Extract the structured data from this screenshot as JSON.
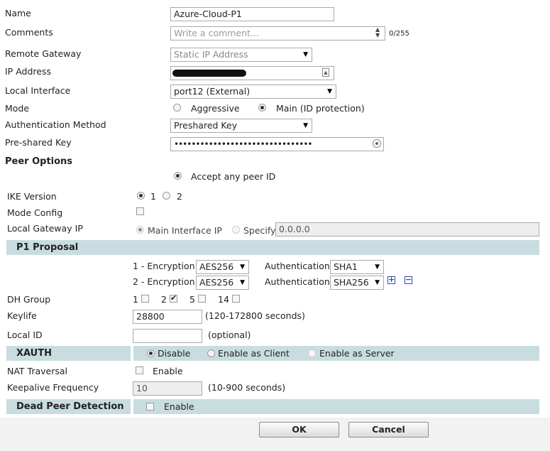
{
  "fields": {
    "name_label": "Name",
    "name_value": "Azure-Cloud-P1",
    "comments_label": "Comments",
    "comments_placeholder": "Write a comment...",
    "comments_count": "0/255",
    "remote_gateway_label": "Remote Gateway",
    "remote_gateway_value": "Static IP Address",
    "ip_address_label": "IP Address",
    "local_interface_label": "Local Interface",
    "local_interface_value": "port12 (External)",
    "mode_label": "Mode",
    "mode_aggressive": "Aggressive",
    "mode_main": "Main (ID protection)",
    "auth_method_label": "Authentication Method",
    "auth_method_value": "Preshared Key",
    "psk_label": "Pre-shared Key",
    "psk_value": "••••••••••••••••••••••••••••••••"
  },
  "peer_options": {
    "title": "Peer Options",
    "accept_any": "Accept any peer ID"
  },
  "ike": {
    "version_label": "IKE Version",
    "v1": "1",
    "v2": "2",
    "mode_config_label": "Mode Config",
    "local_gw_label": "Local Gateway IP",
    "main_interface_ip": "Main Interface IP",
    "specify": "Specify",
    "specify_value": "0.0.0.0"
  },
  "p1_proposal": {
    "title": "P1 Proposal",
    "row1_label": "1 - Encryption",
    "row1_enc": "AES256",
    "row1_auth_label": "Authentication",
    "row1_auth": "SHA1",
    "row2_label": "2 - Encryption",
    "row2_enc": "AES256",
    "row2_auth_label": "Authentication",
    "row2_auth": "SHA256",
    "dh_label": "DH Group",
    "dh1": "1",
    "dh2": "2",
    "dh5": "5",
    "dh14": "14",
    "keylife_label": "Keylife",
    "keylife_value": "28800",
    "keylife_hint": "(120-172800 seconds)",
    "local_id_label": "Local ID",
    "local_id_hint": "(optional)"
  },
  "xauth": {
    "title": "XAUTH",
    "disable": "Disable",
    "client": "Enable as Client",
    "server": "Enable as Server"
  },
  "nat": {
    "label": "NAT Traversal",
    "enable": "Enable",
    "keepalive_label": "Keepalive Frequency",
    "keepalive_value": "10",
    "keepalive_hint": "(10-900 seconds)"
  },
  "dpd": {
    "title": "Dead Peer Detection",
    "enable": "Enable"
  },
  "buttons": {
    "ok": "OK",
    "cancel": "Cancel"
  }
}
